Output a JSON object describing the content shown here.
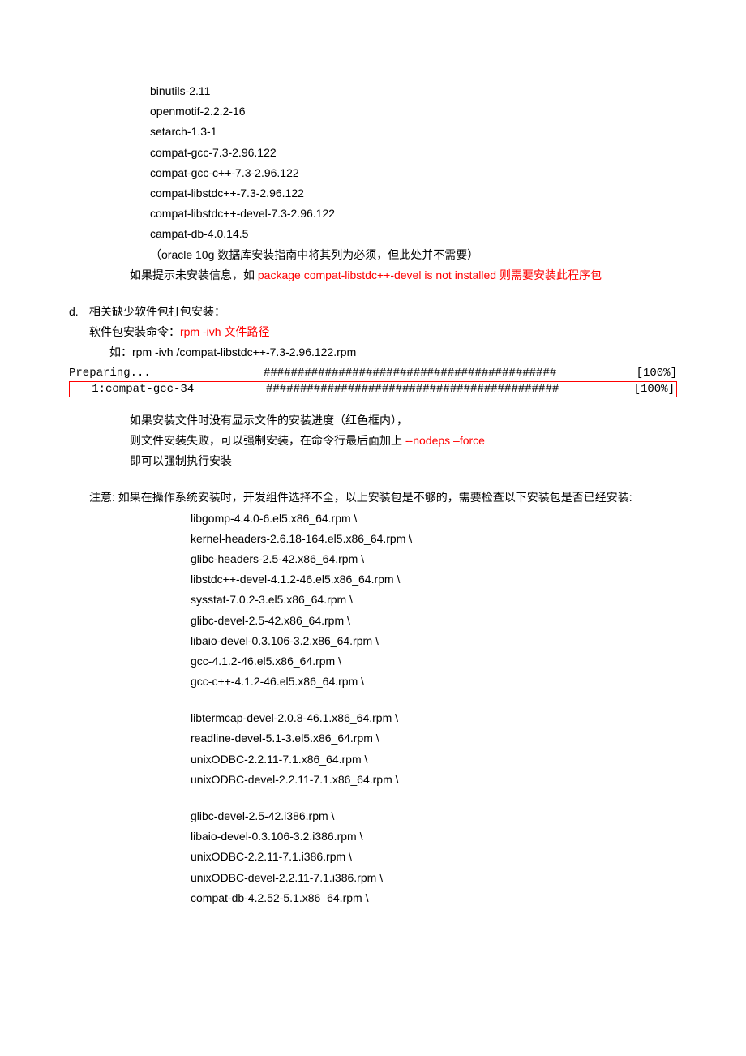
{
  "packages_top": [
    "binutils-2.11",
    "openmotif-2.2.2-16",
    "setarch-1.3-1",
    "compat-gcc-7.3-2.96.122",
    "compat-gcc-c++-7.3-2.96.122",
    "compat-libstdc++-7.3-2.96.122",
    "compat-libstdc++-devel-7.3-2.96.122",
    "campat-db-4.0.14.5"
  ],
  "oracle_note": "（oracle 10g 数据库安装指南中将其列为必须，但此处并不需要）",
  "hint_prefix": "如果提示未安装信息，如 ",
  "hint_red": "package compat-libstdc++-devel is not installed  则需要安装此程序包",
  "section_d": {
    "marker": "d.",
    "title": "相关缺少软件包打包安装：",
    "cmd_label": "软件包安装命令：",
    "cmd_red": "rpm -ivh    文件路径",
    "example": "如：rpm -ivh    /compat-libstdc++-7.3-2.96.122.rpm"
  },
  "terminal": {
    "row1_label": "Preparing...",
    "row1_bar": "###########################################",
    "row1_pct": "[100%]",
    "row2_label": "   1:compat-gcc-34",
    "row2_bar": "###########################################",
    "row2_pct": "[100%]"
  },
  "post_terminal": {
    "line1": "如果安装文件时没有显示文件的安装进度（红色框内），",
    "line2_a": "则文件安装失败，可以强制安装，在命令行最后面加上   ",
    "line2_red": "--nodeps –force",
    "line3": "即可以强制执行安装"
  },
  "notice": "注意: 如果在操作系统安装时，开发组件选择不全，以上安装包是不够的，需要检查以下安装包是否已经安装:",
  "pkg_group1": [
    "libgomp-4.4.0-6.el5.x86_64.rpm \\",
    "kernel-headers-2.6.18-164.el5.x86_64.rpm \\",
    "glibc-headers-2.5-42.x86_64.rpm \\",
    "libstdc++-devel-4.1.2-46.el5.x86_64.rpm \\",
    "sysstat-7.0.2-3.el5.x86_64.rpm \\",
    "glibc-devel-2.5-42.x86_64.rpm \\",
    "libaio-devel-0.3.106-3.2.x86_64.rpm \\",
    "gcc-4.1.2-46.el5.x86_64.rpm \\",
    "gcc-c++-4.1.2-46.el5.x86_64.rpm \\"
  ],
  "pkg_group2": [
    "libtermcap-devel-2.0.8-46.1.x86_64.rpm \\",
    "readline-devel-5.1-3.el5.x86_64.rpm \\",
    "unixODBC-2.2.11-7.1.x86_64.rpm \\",
    "unixODBC-devel-2.2.11-7.1.x86_64.rpm \\"
  ],
  "pkg_group3": [
    "glibc-devel-2.5-42.i386.rpm \\",
    "libaio-devel-0.3.106-3.2.i386.rpm \\",
    "unixODBC-2.2.11-7.1.i386.rpm \\",
    "unixODBC-devel-2.2.11-7.1.i386.rpm \\",
    "compat-db-4.2.52-5.1.x86_64.rpm \\"
  ]
}
